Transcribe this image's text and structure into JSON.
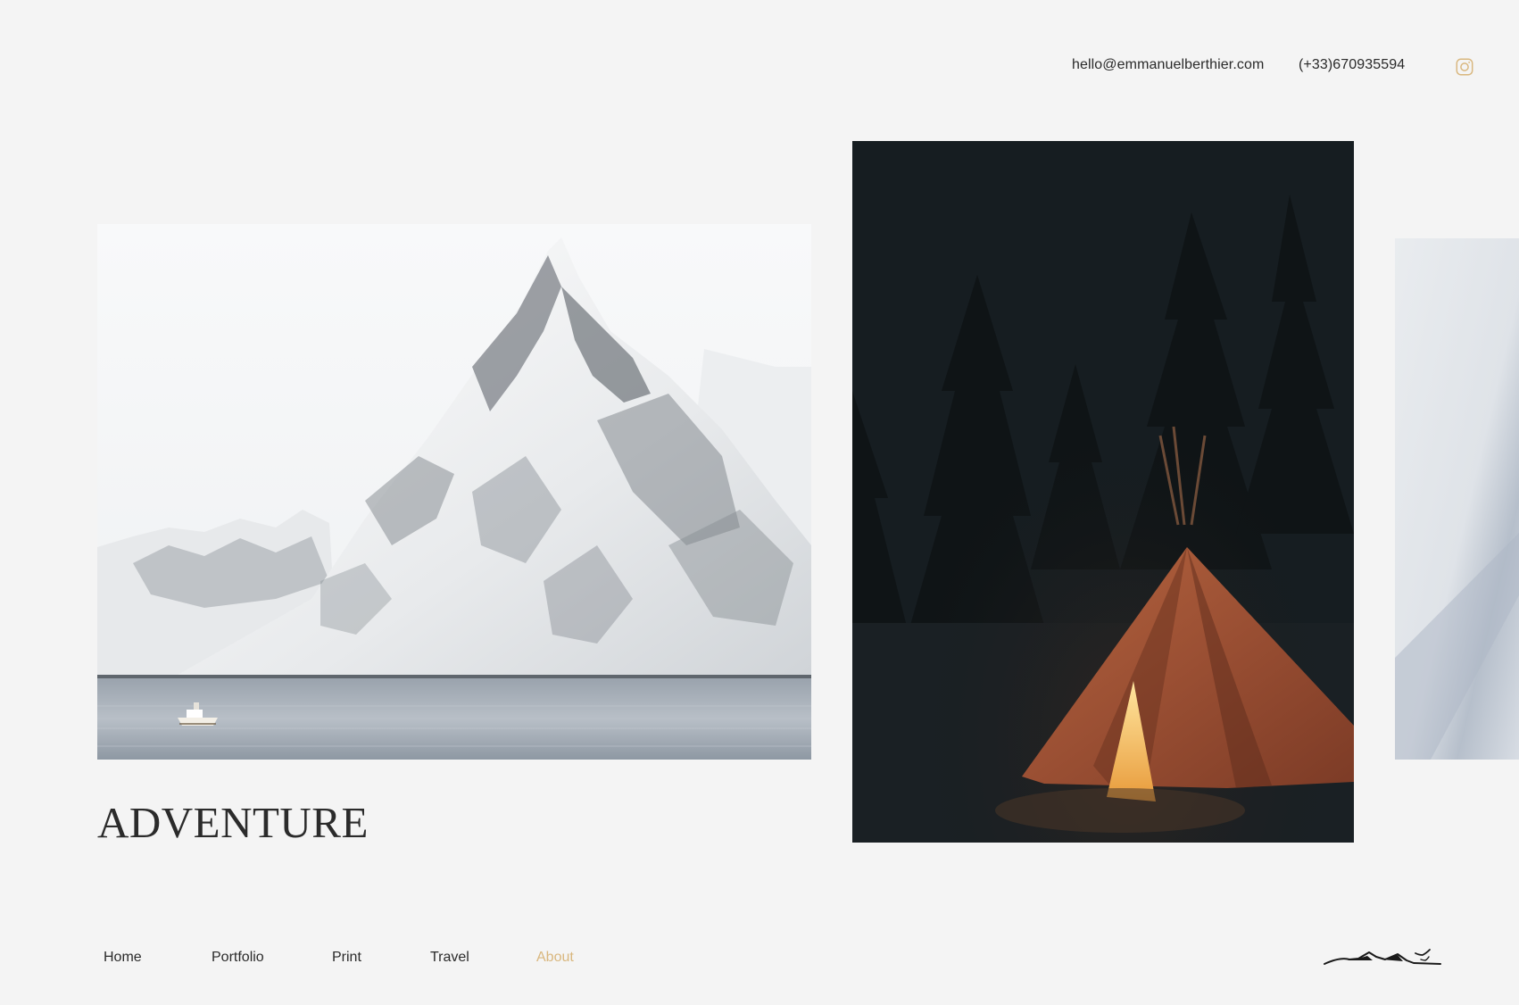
{
  "header": {
    "email": "hello@emmanuelberthier.com",
    "phone": "(+33)670935594",
    "instagram_icon": "instagram-icon",
    "accent_color": "#d9b77e"
  },
  "gallery": {
    "title": "ADVENTURE",
    "photos": [
      {
        "name": "snowy-mountain-fjord-photo"
      },
      {
        "name": "glowing-tent-night-forest-photo"
      },
      {
        "name": "snow-texture-photo"
      }
    ]
  },
  "nav": {
    "items": [
      {
        "label": "Home",
        "active": false
      },
      {
        "label": "Portfolio",
        "active": false
      },
      {
        "label": "Print",
        "active": false
      },
      {
        "label": "Travel",
        "active": false
      },
      {
        "label": "About",
        "active": true
      }
    ]
  },
  "logo": {
    "icon": "mountain-birds-logo"
  }
}
